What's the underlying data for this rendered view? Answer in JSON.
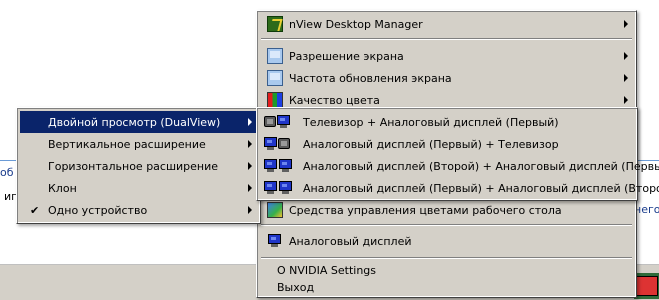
{
  "background": {
    "link_1": "об",
    "link_2": "иг",
    "link_3": "него"
  },
  "main_menu": {
    "nview": "nView Desktop Manager",
    "resolution": "Разрешение экрана",
    "refresh": "Частота обновления экрана",
    "color_quality": "Качество цвета",
    "dualview": "Двойной просмотр (DualView)",
    "color_tools": "Средства управления цветами рабочего стола",
    "analog_display": "Аналоговый дисплей",
    "about": "О NVIDIA Settings",
    "exit": "Выход"
  },
  "dual_submenu": {
    "items": [
      "Двойной просмотр (DualView)",
      "Вертикальное расширение",
      "Горизонтальное расширение",
      "Клон",
      "Одно устройство"
    ],
    "checked_item": "Одно устройство",
    "check_mark": "✔"
  },
  "display_submenu": {
    "items": [
      "Телевизор + Аналоговый дисплей (Первый)",
      "Аналоговый дисплей (Первый) + Телевизор",
      "Аналоговый дисплей (Второй) + Аналоговый дисплей (Первый)",
      "Аналоговый дисплей (Первый) + Аналоговый дисплей (Второй)"
    ]
  },
  "colors": {
    "menu_bg": "#d4d0c8",
    "highlight": "#0a246a",
    "highlight_text": "#ffffff"
  },
  "icons": {
    "nview": "nview-icon",
    "resolution": "screen-icon",
    "refresh": "screen-icon",
    "color_quality": "color-bars-icon",
    "tv": "tv-icon",
    "monitor": "monitor-icon",
    "color_tools": "color-tools-icon"
  }
}
